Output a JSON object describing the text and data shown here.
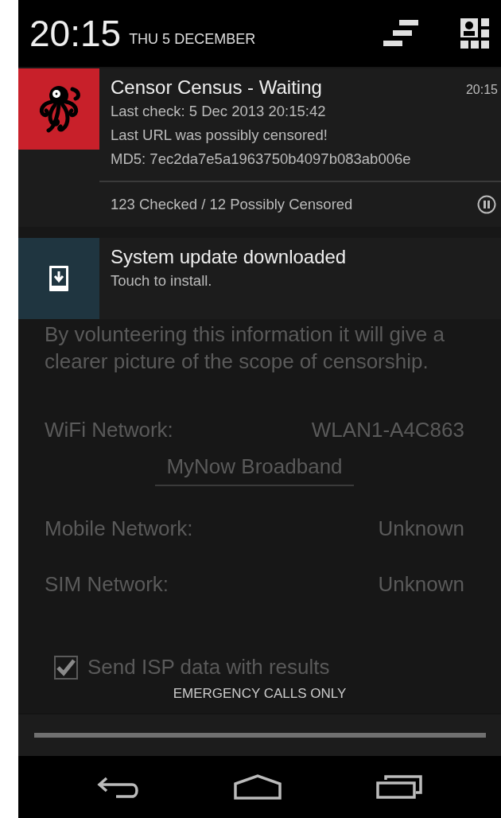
{
  "status_header": {
    "time": "20:15",
    "date": "THU 5 DECEMBER"
  },
  "notifications": [
    {
      "kind": "app",
      "color": "#c8202a",
      "title": "Censor Census - Waiting",
      "time": "20:15",
      "lines": [
        "Last check: 5 Dec 2013 20:15:42",
        "Last URL was possibly censored!",
        "MD5: 7ec2da7e5a1963750b4097b083ab006e"
      ],
      "action": {
        "label": "123 Checked / 12 Possibly Censored"
      }
    },
    {
      "kind": "system",
      "color": "#1f3540",
      "title": "System update downloaded",
      "lines": [
        "Touch to install."
      ]
    }
  ],
  "background_app": {
    "paragraph": "By volunteering this information it will give a clearer picture of the scope of censorship.",
    "rows": [
      {
        "kind": "pair",
        "label": "WiFi Network:",
        "value": "WLAN1-A4C863"
      },
      {
        "kind": "spinner",
        "value": "MyNow Broadband"
      },
      {
        "kind": "pair",
        "label": "Mobile Network:",
        "value": "Unknown"
      },
      {
        "kind": "pair",
        "label": "SIM Network:",
        "value": "Unknown"
      }
    ],
    "checkbox": {
      "label": "Send ISP data with results",
      "checked": true
    }
  },
  "carrier_label": "EMERGENCY CALLS ONLY"
}
